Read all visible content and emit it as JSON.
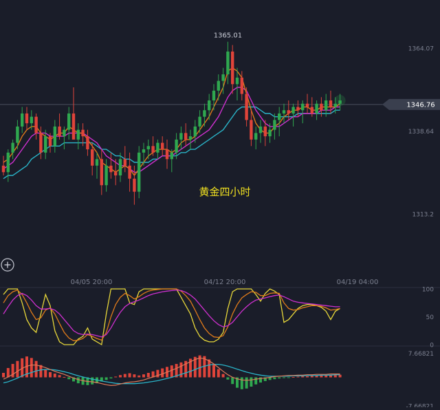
{
  "chart_data": [
    {
      "type": "candlestick",
      "title": "黄金四小时",
      "x_ticks": [
        "04/05 20:00",
        "04/12 20:00",
        "04/19 04:00"
      ],
      "y_ticks": [
        "1364.07",
        "1338.64",
        "1313.2"
      ],
      "ylim": [
        1294.4,
        1376.7
      ],
      "peak_label": "1365.01",
      "current_price_label": "1346.76",
      "current_price": 1346.76,
      "colors": {
        "up": "#2fa84f",
        "down": "#e0443a",
        "ma_fast": "#e07b1a",
        "ma_mid": "#d030d0",
        "ma_slow": "#2ab4c8",
        "title": "#f0e020"
      },
      "ohlc": [
        [
          1328,
          1331,
          1325,
          1326
        ],
        [
          1326,
          1333,
          1323,
          1332
        ],
        [
          1332,
          1336,
          1330,
          1335
        ],
        [
          1335,
          1342,
          1333,
          1340
        ],
        [
          1340,
          1346,
          1338,
          1344
        ],
        [
          1344,
          1346,
          1339,
          1341
        ],
        [
          1341,
          1345,
          1339,
          1343
        ],
        [
          1343,
          1344,
          1336,
          1338
        ],
        [
          1338,
          1340,
          1330,
          1332
        ],
        [
          1332,
          1339,
          1330,
          1337
        ],
        [
          1337,
          1338,
          1332,
          1334
        ],
        [
          1334,
          1342,
          1332,
          1340
        ],
        [
          1340,
          1344,
          1336,
          1337
        ],
        [
          1337,
          1340,
          1333,
          1339
        ],
        [
          1339,
          1346,
          1336,
          1344
        ],
        [
          1344,
          1352,
          1339,
          1336
        ],
        [
          1336,
          1341,
          1333,
          1339
        ],
        [
          1339,
          1341,
          1334,
          1337
        ],
        [
          1337,
          1339,
          1331,
          1333
        ],
        [
          1333,
          1335,
          1325,
          1328
        ],
        [
          1328,
          1332,
          1324,
          1330
        ],
        [
          1330,
          1333,
          1319,
          1322
        ],
        [
          1322,
          1330,
          1320,
          1328
        ],
        [
          1328,
          1332,
          1324,
          1326
        ],
        [
          1326,
          1330,
          1322,
          1325
        ],
        [
          1325,
          1332,
          1323,
          1330
        ],
        [
          1330,
          1334,
          1326,
          1328
        ],
        [
          1328,
          1332,
          1320,
          1324
        ],
        [
          1324,
          1328,
          1316,
          1320
        ],
        [
          1320,
          1334,
          1318,
          1332
        ],
        [
          1332,
          1335,
          1328,
          1333
        ],
        [
          1333,
          1336,
          1330,
          1334
        ],
        [
          1334,
          1337,
          1331,
          1332
        ],
        [
          1332,
          1336,
          1330,
          1335
        ],
        [
          1335,
          1337,
          1331,
          1333
        ],
        [
          1333,
          1336,
          1327,
          1330
        ],
        [
          1330,
          1333,
          1326,
          1332
        ],
        [
          1332,
          1338,
          1330,
          1336
        ],
        [
          1336,
          1340,
          1333,
          1338
        ],
        [
          1338,
          1341,
          1334,
          1336
        ],
        [
          1336,
          1339,
          1333,
          1337
        ],
        [
          1337,
          1342,
          1335,
          1340
        ],
        [
          1340,
          1345,
          1338,
          1343
        ],
        [
          1343,
          1347,
          1340,
          1345
        ],
        [
          1345,
          1350,
          1342,
          1348
        ],
        [
          1348,
          1353,
          1345,
          1351
        ],
        [
          1351,
          1356,
          1348,
          1354
        ],
        [
          1354,
          1358,
          1350,
          1356
        ],
        [
          1356,
          1366,
          1353,
          1363
        ],
        [
          1363,
          1365,
          1350,
          1353
        ],
        [
          1353,
          1358,
          1348,
          1355
        ],
        [
          1355,
          1357,
          1348,
          1350
        ],
        [
          1350,
          1352,
          1340,
          1342
        ],
        [
          1342,
          1345,
          1334,
          1336
        ],
        [
          1336,
          1340,
          1333,
          1338
        ],
        [
          1338,
          1342,
          1335,
          1340
        ],
        [
          1340,
          1342,
          1334,
          1337
        ],
        [
          1337,
          1341,
          1335,
          1339
        ],
        [
          1339,
          1344,
          1336,
          1342
        ],
        [
          1342,
          1346,
          1337,
          1344
        ],
        [
          1344,
          1347,
          1341,
          1345
        ],
        [
          1345,
          1348,
          1342,
          1344
        ],
        [
          1344,
          1347,
          1340,
          1346
        ],
        [
          1346,
          1348,
          1343,
          1345
        ],
        [
          1345,
          1348,
          1341,
          1347
        ],
        [
          1347,
          1350,
          1344,
          1346
        ],
        [
          1346,
          1349,
          1343,
          1344
        ],
        [
          1344,
          1348,
          1342,
          1347
        ],
        [
          1347,
          1349,
          1343,
          1345
        ],
        [
          1345,
          1350,
          1343,
          1348
        ],
        [
          1348,
          1351,
          1344,
          1346
        ],
        [
          1346,
          1349,
          1344,
          1347
        ],
        [
          1347,
          1350,
          1345,
          1348
        ]
      ],
      "ma_fast": [
        1329,
        1330,
        1332,
        1334,
        1337,
        1339,
        1340,
        1340,
        1338,
        1337,
        1336,
        1337,
        1338,
        1338,
        1340,
        1339,
        1338,
        1338,
        1336,
        1334,
        1332,
        1329,
        1328,
        1327,
        1326,
        1327,
        1328,
        1327,
        1325,
        1327,
        1329,
        1331,
        1332,
        1333,
        1333,
        1333,
        1332,
        1333,
        1335,
        1336,
        1336,
        1337,
        1339,
        1341,
        1343,
        1346,
        1349,
        1352,
        1357,
        1358,
        1357,
        1355,
        1350,
        1345,
        1341,
        1339,
        1338,
        1338,
        1340,
        1341,
        1343,
        1344,
        1345,
        1345,
        1346,
        1346,
        1345,
        1345,
        1346,
        1346,
        1346,
        1346,
        1347
      ],
      "ma_mid": [
        1327,
        1328,
        1329,
        1331,
        1333,
        1335,
        1337,
        1338,
        1338,
        1338,
        1337,
        1337,
        1337,
        1337,
        1338,
        1338,
        1338,
        1338,
        1337,
        1336,
        1335,
        1333,
        1331,
        1330,
        1329,
        1328,
        1328,
        1327,
        1326,
        1326,
        1327,
        1328,
        1329,
        1330,
        1331,
        1331,
        1331,
        1332,
        1333,
        1334,
        1335,
        1336,
        1337,
        1338,
        1339,
        1341,
        1343,
        1346,
        1349,
        1351,
        1352,
        1352,
        1351,
        1348,
        1345,
        1343,
        1341,
        1340,
        1340,
        1340,
        1341,
        1342,
        1343,
        1343,
        1344,
        1344,
        1344,
        1344,
        1345,
        1345,
        1345,
        1346,
        1346
      ],
      "ma_slow": [
        1324,
        1325,
        1325,
        1326,
        1327,
        1328,
        1330,
        1331,
        1332,
        1333,
        1334,
        1334,
        1334,
        1335,
        1335,
        1335,
        1335,
        1335,
        1335,
        1335,
        1334,
        1333,
        1333,
        1332,
        1331,
        1331,
        1330,
        1330,
        1329,
        1329,
        1329,
        1329,
        1330,
        1330,
        1331,
        1331,
        1331,
        1331,
        1332,
        1332,
        1333,
        1333,
        1334,
        1335,
        1336,
        1337,
        1338,
        1339,
        1341,
        1343,
        1345,
        1346,
        1346,
        1346,
        1346,
        1345,
        1344,
        1344,
        1343,
        1343,
        1343,
        1343,
        1343,
        1344,
        1344,
        1344,
        1344,
        1344,
        1344,
        1344,
        1344,
        1345,
        1345
      ]
    },
    {
      "type": "line",
      "y_ticks": [
        "100",
        "50",
        "0"
      ],
      "ylim": [
        0,
        100
      ],
      "series": [
        {
          "color": "#e8d83a",
          "values": [
            90,
            100,
            100,
            100,
            75,
            45,
            30,
            22,
            55,
            90,
            70,
            25,
            5,
            0,
            0,
            0,
            10,
            15,
            30,
            10,
            5,
            0,
            55,
            100,
            100,
            100,
            100,
            75,
            72,
            95,
            100,
            100,
            100,
            100,
            100,
            100,
            100,
            100,
            85,
            70,
            55,
            30,
            15,
            8,
            5,
            5,
            10,
            22,
            65,
            95,
            100,
            100,
            100,
            100,
            90,
            78,
            92,
            100,
            96,
            90,
            40,
            45,
            55,
            65,
            70,
            72,
            72,
            70,
            67,
            60,
            45,
            60,
            65
          ]
        },
        {
          "color": "#e07b1a",
          "values": [
            75,
            88,
            95,
            98,
            90,
            75,
            58,
            45,
            48,
            62,
            66,
            55,
            38,
            22,
            12,
            7,
            8,
            11,
            18,
            15,
            11,
            8,
            22,
            50,
            72,
            85,
            92,
            88,
            82,
            86,
            92,
            96,
            98,
            99,
            100,
            100,
            100,
            100,
            96,
            88,
            78,
            62,
            45,
            30,
            20,
            14,
            13,
            16,
            32,
            55,
            72,
            84,
            90,
            95,
            94,
            88,
            88,
            92,
            93,
            92,
            75,
            65,
            62,
            63,
            66,
            68,
            70,
            70,
            69,
            66,
            62,
            63,
            65
          ]
        },
        {
          "color": "#d030d0",
          "values": [
            55,
            68,
            80,
            88,
            92,
            88,
            80,
            70,
            64,
            64,
            65,
            62,
            55,
            45,
            35,
            25,
            20,
            18,
            19,
            18,
            16,
            14,
            18,
            30,
            45,
            58,
            68,
            74,
            77,
            80,
            84,
            88,
            91,
            93,
            95,
            96,
            97,
            98,
            97,
            94,
            89,
            82,
            72,
            62,
            52,
            43,
            36,
            32,
            34,
            40,
            50,
            60,
            68,
            75,
            80,
            82,
            84,
            86,
            88,
            89,
            86,
            82,
            78,
            76,
            75,
            74,
            73,
            72,
            71,
            70,
            69,
            68,
            68
          ]
        }
      ]
    },
    {
      "type": "bar",
      "y_ticks": [
        "7.66821",
        "-7.66821"
      ],
      "ylim": [
        -7.66821,
        7.66821
      ],
      "histogram": [
        1.2,
        2.5,
        3.6,
        4.4,
        5.1,
        5.6,
        5.2,
        4.4,
        3.3,
        2.2,
        1.4,
        1.0,
        0.6,
        0.1,
        -0.5,
        -1.1,
        -1.6,
        -2.0,
        -2.1,
        -1.9,
        -1.6,
        -1.1,
        -0.7,
        -0.3,
        0.2,
        0.6,
        0.9,
        1.1,
        0.8,
        0.5,
        0.8,
        1.2,
        1.6,
        2.0,
        2.4,
        2.8,
        3.2,
        3.6,
        4.0,
        4.4,
        5.0,
        5.5,
        5.9,
        5.7,
        4.8,
        3.6,
        2.2,
        0.9,
        -0.6,
        -1.8,
        -2.8,
        -3.2,
        -3.0,
        -2.5,
        -1.9,
        -1.4,
        -1.0,
        -0.7,
        -0.5,
        -0.3,
        -0.2,
        -0.1,
        0.1,
        0.2,
        0.3,
        0.3,
        0.4,
        0.4,
        0.5,
        0.5,
        0.6,
        0.6,
        0.7
      ],
      "dif": [
        -0.5,
        0.1,
        0.8,
        1.6,
        2.4,
        3.0,
        3.3,
        3.3,
        3.0,
        2.6,
        2.1,
        1.6,
        1.2,
        0.8,
        0.3,
        -0.2,
        -0.6,
        -0.9,
        -1.1,
        -1.2,
        -1.4,
        -1.7,
        -2.0,
        -2.2,
        -2.1,
        -1.8,
        -1.5,
        -1.3,
        -1.2,
        -1.0,
        -0.7,
        -0.3,
        0.1,
        0.5,
        0.9,
        1.4,
        1.9,
        2.4,
        3.0,
        3.6,
        4.2,
        4.8,
        5.2,
        5.0,
        4.4,
        3.6,
        2.6,
        1.6,
        0.7,
        0.0,
        -0.4,
        -0.7,
        -0.8,
        -0.7,
        -0.5,
        -0.3,
        -0.2,
        0.0,
        0.2,
        0.3,
        0.4,
        0.5,
        0.5,
        0.6,
        0.6,
        0.7,
        0.7,
        0.8,
        0.8,
        0.8,
        0.9,
        0.9,
        0.9
      ],
      "dea": [
        -1.5,
        -1.2,
        -0.7,
        -0.2,
        0.4,
        0.9,
        1.3,
        1.7,
        2.0,
        2.1,
        2.1,
        2.0,
        1.8,
        1.5,
        1.2,
        0.8,
        0.4,
        0.1,
        -0.2,
        -0.5,
        -0.7,
        -1.0,
        -1.2,
        -1.4,
        -1.6,
        -1.7,
        -1.7,
        -1.7,
        -1.7,
        -1.6,
        -1.5,
        -1.3,
        -1.1,
        -0.9,
        -0.6,
        -0.3,
        0.0,
        0.4,
        0.8,
        1.2,
        1.6,
        2.1,
        2.6,
        3.0,
        3.3,
        3.5,
        3.5,
        3.3,
        3.0,
        2.6,
        2.2,
        1.8,
        1.4,
        1.1,
        0.8,
        0.6,
        0.4,
        0.3,
        0.3,
        0.3,
        0.3,
        0.3,
        0.4,
        0.4,
        0.4,
        0.5,
        0.5,
        0.5,
        0.6,
        0.6,
        0.6,
        0.7,
        0.7
      ]
    }
  ]
}
